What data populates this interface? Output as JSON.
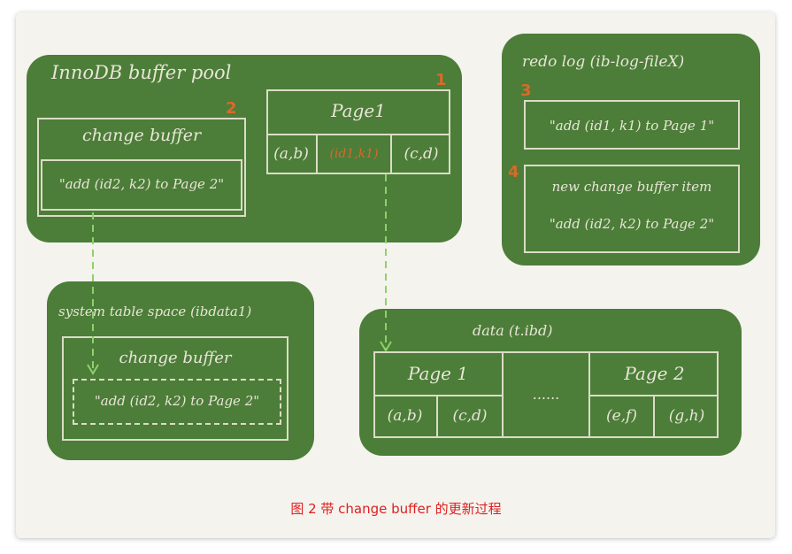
{
  "buffer_pool": {
    "title": "InnoDB buffer pool",
    "change_buffer_label": "change buffer",
    "change_buffer_item": "\"add (id2, k2) to Page 2\"",
    "step_change_buffer": "2",
    "page1_label": "Page1",
    "step_page1": "1",
    "page1_cells": [
      "(a,b)",
      "(id1,k1)",
      "(c,d)"
    ]
  },
  "redo_log": {
    "title": "redo log (ib-log-fileX)",
    "step_a": "3",
    "entry_1": "\"add (id1, k1) to Page 1\"",
    "step_b": "4",
    "entry_2_line1": "new change buffer item",
    "entry_2_line2": "\"add (id2, k2) to Page 2\""
  },
  "system_tablespace": {
    "title": "system table space (ibdata1)",
    "change_buffer_label": "change buffer",
    "change_buffer_item": "\"add (id2, k2) to Page 2\""
  },
  "data_file": {
    "title": "data (t.ibd)",
    "page1_label": "Page 1",
    "page2_label": "Page 2",
    "ellipsis": "......",
    "page1_cells": [
      "(a,b)",
      "(c,d)"
    ],
    "page2_cells": [
      "(e,f)",
      "(g,h)"
    ]
  },
  "caption": "图 2 带 change buffer 的更新过程",
  "colors": {
    "pane_green": "#4c7d39",
    "chalk": "#e8e6d6",
    "arrow": "#8fd16a",
    "step_orange": "#d86a2a",
    "caption_red": "#e02020"
  }
}
